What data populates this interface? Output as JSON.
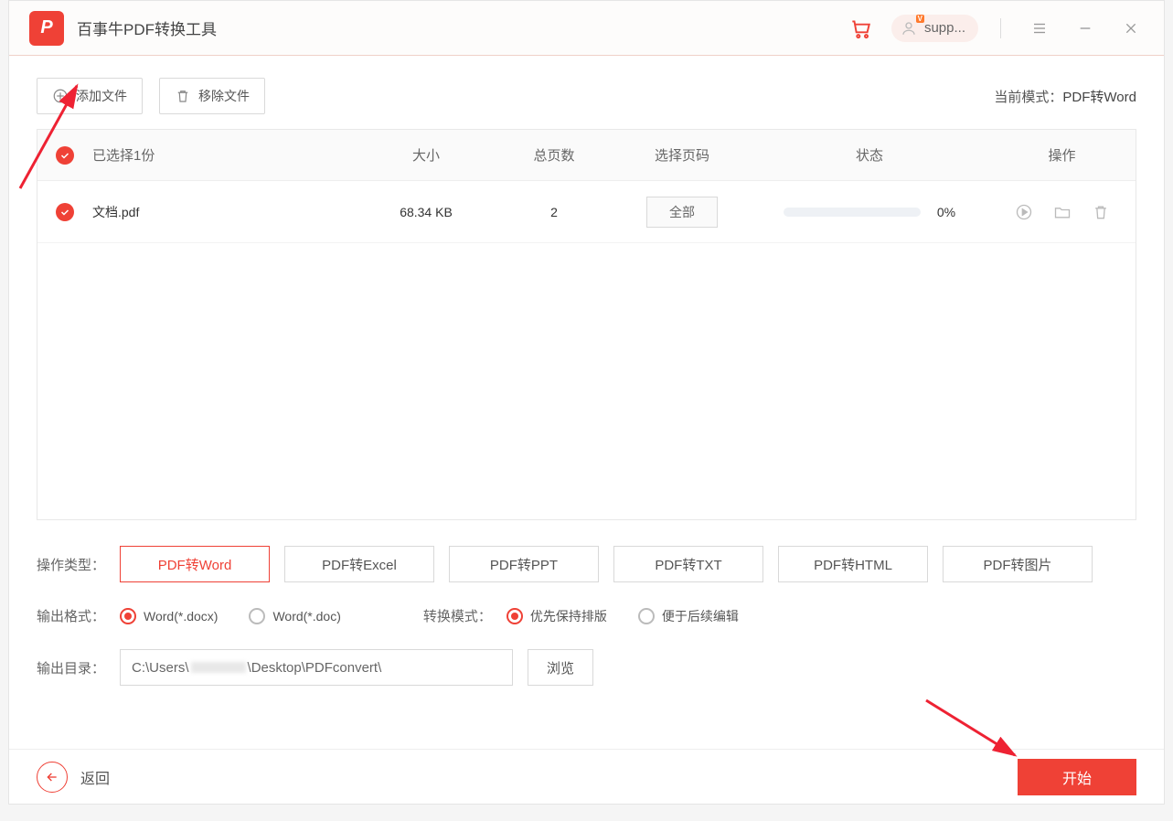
{
  "app": {
    "title": "百事牛PDF转换工具",
    "user": "supp...",
    "vip": "V"
  },
  "toolbar": {
    "add_file": "添加文件",
    "remove_file": "移除文件"
  },
  "mode": {
    "label": "当前模式：",
    "value": "PDF转Word"
  },
  "table": {
    "headers": {
      "selected": "已选择1份",
      "size": "大小",
      "pages": "总页数",
      "range": "选择页码",
      "status": "状态",
      "actions": "操作"
    },
    "rows": [
      {
        "name": "文档.pdf",
        "size": "68.34 KB",
        "pages": "2",
        "range": "全部",
        "progress": "0%"
      }
    ]
  },
  "operation": {
    "label": "操作类型：",
    "types": [
      "PDF转Word",
      "PDF转Excel",
      "PDF转PPT",
      "PDF转TXT",
      "PDF转HTML",
      "PDF转图片"
    ]
  },
  "format": {
    "label": "输出格式：",
    "options": [
      "Word(*.docx)",
      "Word(*.doc)"
    ]
  },
  "convert_mode": {
    "label": "转换模式：",
    "options": [
      "优先保持排版",
      "便于后续编辑"
    ]
  },
  "output": {
    "label": "输出目录：",
    "path_pre": "C:\\Users\\",
    "path_post": "\\Desktop\\PDFconvert\\",
    "browse": "浏览"
  },
  "footer": {
    "back": "返回",
    "start": "开始"
  }
}
